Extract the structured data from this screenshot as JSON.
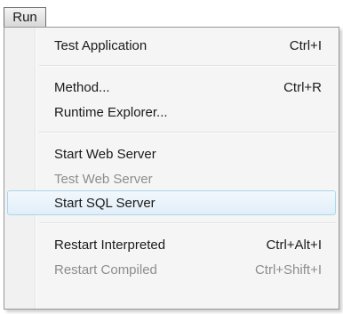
{
  "menubar": {
    "run_label": "Run"
  },
  "menu": {
    "items": [
      {
        "label": "Test Application",
        "shortcut": "Ctrl+I",
        "disabled": false
      },
      {
        "label": "Method...",
        "shortcut": "Ctrl+R",
        "disabled": false
      },
      {
        "label": "Runtime Explorer...",
        "shortcut": "",
        "disabled": false
      },
      {
        "label": "Start Web Server",
        "shortcut": "",
        "disabled": false
      },
      {
        "label": "Test Web Server",
        "shortcut": "",
        "disabled": true
      },
      {
        "label": "Start SQL Server",
        "shortcut": "",
        "disabled": false,
        "highlighted": true
      },
      {
        "label": "Restart Interpreted",
        "shortcut": "Ctrl+Alt+I",
        "disabled": false
      },
      {
        "label": "Restart Compiled",
        "shortcut": "Ctrl+Shift+I",
        "disabled": true
      }
    ]
  },
  "colors": {
    "highlight_border": "#a8d8eb",
    "highlight_fill": "#e1eef9",
    "disabled_text": "#8d8d8d"
  }
}
